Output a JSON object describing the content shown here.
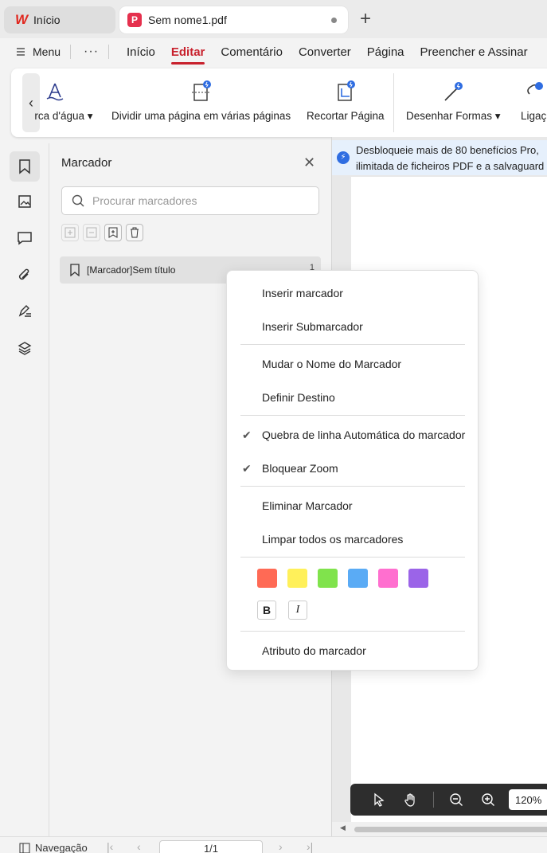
{
  "tabs": {
    "home_label": "Início",
    "home_logo": "W",
    "doc_label": "Sem nome1.pdf"
  },
  "menu": {
    "menu_label": "Menu",
    "more_label": "···",
    "items": [
      "Início",
      "Editar",
      "Comentário",
      "Converter",
      "Página",
      "Preencher e Assinar"
    ],
    "active": "Editar"
  },
  "ribbon": {
    "watermark_label": "rca d'água",
    "split_label": "Dividir uma página em várias páginas",
    "crop_label": "Recortar Página",
    "draw_label": "Desenhar Formas",
    "link_label": "Ligaç"
  },
  "panel": {
    "title": "Marcador",
    "search_placeholder": "Procurar marcadores",
    "bookmark_label": "[Marcador]Sem título",
    "bookmark_page": "1"
  },
  "notice": {
    "line1": "Desbloqueie mais de 80 benefícios Pro,",
    "line2": "ilimitada de ficheiros PDF e a salvaguard"
  },
  "context_menu": {
    "insert_bookmark": "Inserir marcador",
    "insert_sub": "Inserir Submarcador",
    "rename": "Mudar o Nome do Marcador",
    "set_destination": "Definir Destino",
    "auto_wrap": "Quebra de linha Automática do marcador",
    "lock_zoom": "Bloquear Zoom",
    "delete": "Eliminar Marcador",
    "clear_all": "Limpar todos os marcadores",
    "attribute": "Atributo do marcador",
    "bold_label": "B",
    "italic_label": "I",
    "colors": [
      "#ff6a55",
      "#fff05a",
      "#80e34c",
      "#5aabf5",
      "#ff6fcf",
      "#9b64e8"
    ]
  },
  "zoom": {
    "value": "120%"
  },
  "status": {
    "nav_label": "Navegação",
    "page_value": "1/1"
  },
  "colors": {
    "accent": "#c8212d",
    "brand_red": "#e0281f",
    "pro_blue": "#2f6de1"
  }
}
